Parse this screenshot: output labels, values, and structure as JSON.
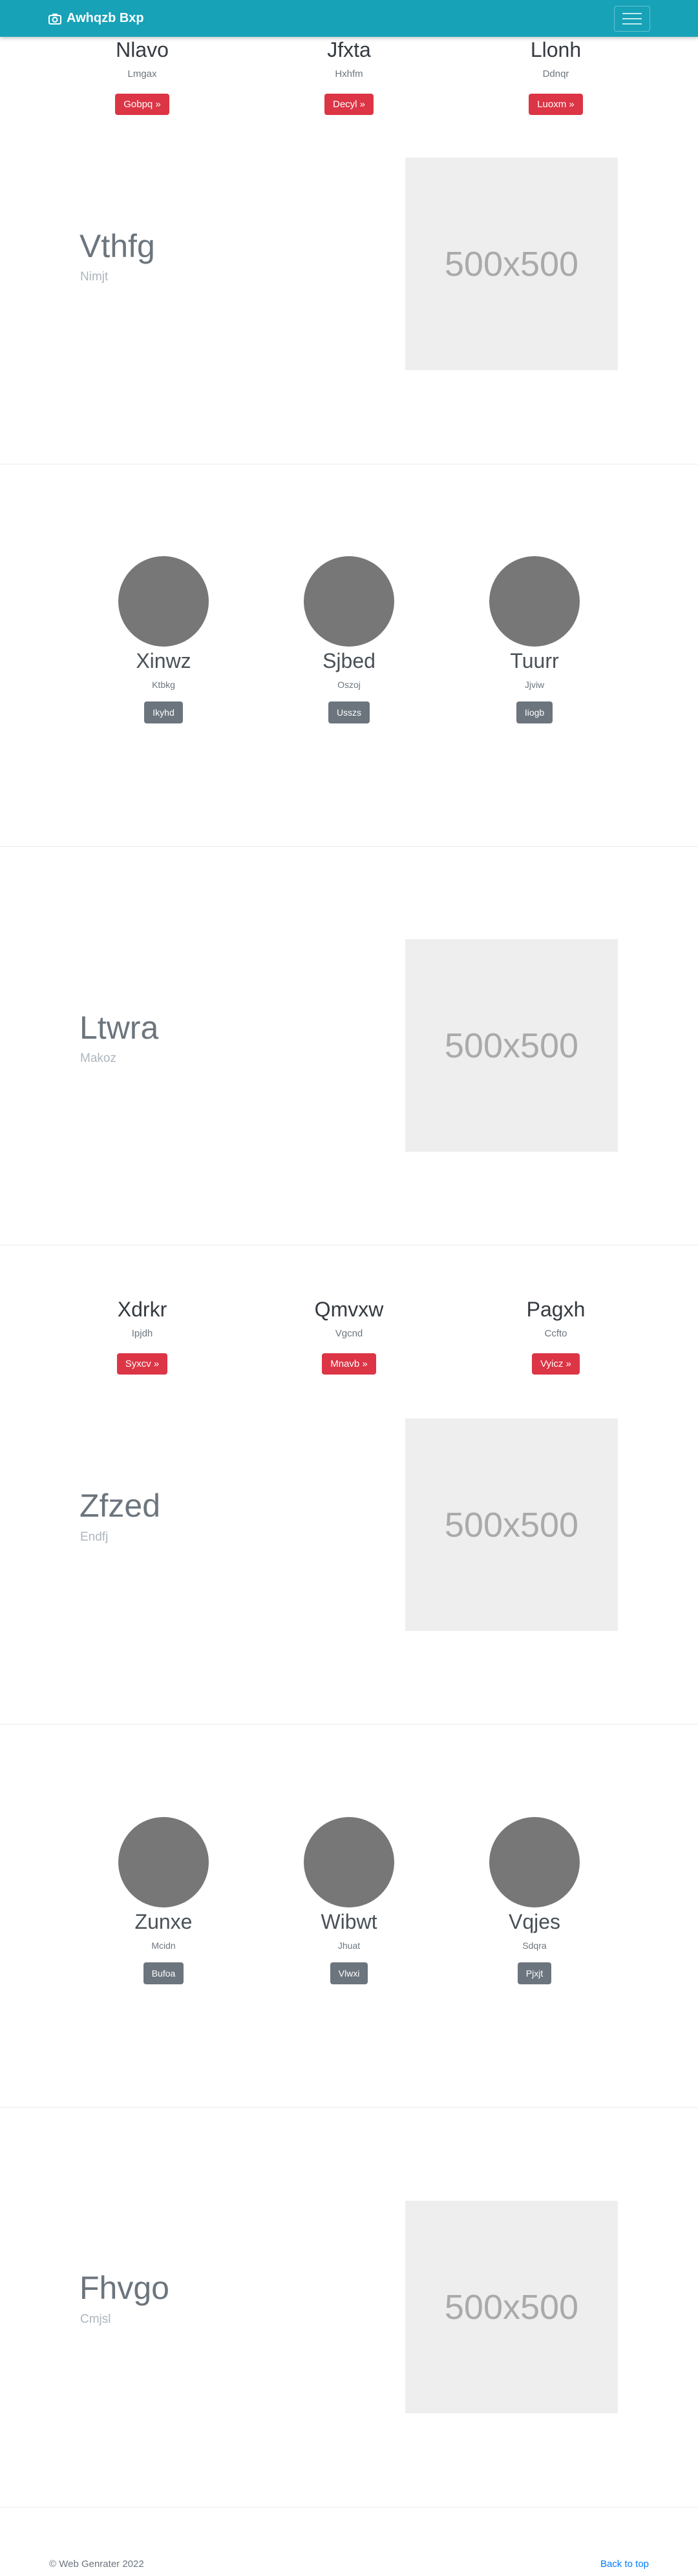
{
  "navbar": {
    "brand": "Awhqzb Bxp",
    "brand_icon": "camera-icon",
    "toggler_icon": "hamburger-icon",
    "color": "#17a2b8"
  },
  "row1": [
    {
      "title": "Nlavo",
      "sub": "Lmgax",
      "button": "Gobpq »"
    },
    {
      "title": "Jfxta",
      "sub": "Hxhfm",
      "button": "Decyl »"
    },
    {
      "title": "Llonh",
      "sub": "Ddnqr",
      "button": "Luoxm »"
    }
  ],
  "hero1": {
    "title": "Vthfg",
    "sub": "Nimjt",
    "placeholder": "500x500"
  },
  "circles1": [
    {
      "title": "Xinwz",
      "sub": "Ktbkg",
      "button": "Ikyhd"
    },
    {
      "title": "Sjbed",
      "sub": "Oszoj",
      "button": "Usszs"
    },
    {
      "title": "Tuurr",
      "sub": "Jjviw",
      "button": "Iiogb"
    }
  ],
  "hero2": {
    "title": "Ltwra",
    "sub": "Makoz",
    "placeholder": "500x500"
  },
  "row2": [
    {
      "title": "Xdrkr",
      "sub": "Ipjdh",
      "button": "Syxcv »"
    },
    {
      "title": "Qmvxw",
      "sub": "Vgcnd",
      "button": "Mnavb »"
    },
    {
      "title": "Pagxh",
      "sub": "Ccfto",
      "button": "Vyicz »"
    }
  ],
  "hero3": {
    "title": "Zfzed",
    "sub": "Endfj",
    "placeholder": "500x500"
  },
  "circles2": [
    {
      "title": "Zunxe",
      "sub": "Mcidn",
      "button": "Bufoa"
    },
    {
      "title": "Wibwt",
      "sub": "Jhuat",
      "button": "Vlwxi"
    },
    {
      "title": "Vqjes",
      "sub": "Sdqra",
      "button": "Pjxjt"
    }
  ],
  "hero4": {
    "title": "Fhvgo",
    "sub": "Cmjsl",
    "placeholder": "500x500"
  },
  "footer": {
    "copyright": "© Web Genrater 2022",
    "back_to_top": "Back to top"
  },
  "colors": {
    "danger": "#dc3545",
    "secondary": "#6c757d",
    "link": "#007bff"
  }
}
